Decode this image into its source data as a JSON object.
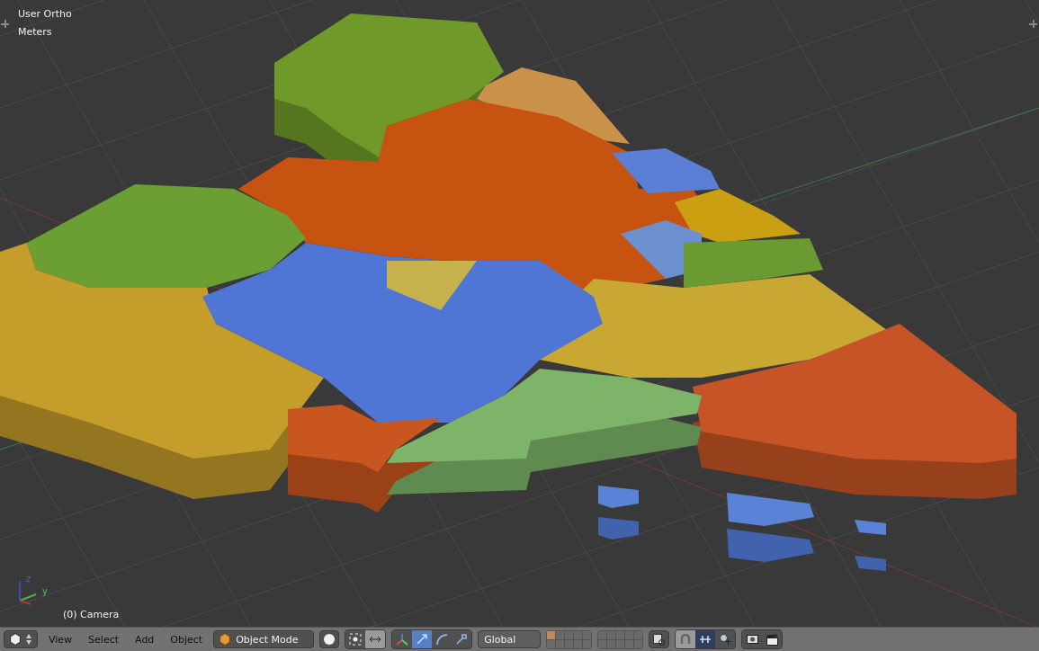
{
  "viewport": {
    "view_name": "User Ortho",
    "units": "Meters",
    "object_label": "(0) Camera",
    "gizmo_axes": [
      "z",
      "y"
    ]
  },
  "header": {
    "menus": [
      "View",
      "Select",
      "Add",
      "Object"
    ],
    "mode": "Object Mode",
    "orientation": "Global",
    "manipulators": [
      {
        "kind": "translate",
        "selected": true
      },
      {
        "kind": "rotate",
        "selected": false
      },
      {
        "kind": "scale",
        "selected": false
      }
    ],
    "layers": [
      {
        "active": true
      },
      {
        "active": false
      },
      {
        "active": false
      },
      {
        "active": false
      },
      {
        "active": false
      },
      {
        "active": false
      },
      {
        "active": false
      },
      {
        "active": false
      },
      {
        "active": false
      },
      {
        "active": false
      },
      {
        "active": false
      },
      {
        "active": false
      },
      {
        "active": false
      },
      {
        "active": false
      },
      {
        "active": false
      },
      {
        "active": false
      },
      {
        "active": false
      },
      {
        "active": false
      },
      {
        "active": false
      },
      {
        "active": false
      }
    ],
    "snap": {
      "on": false
    }
  }
}
